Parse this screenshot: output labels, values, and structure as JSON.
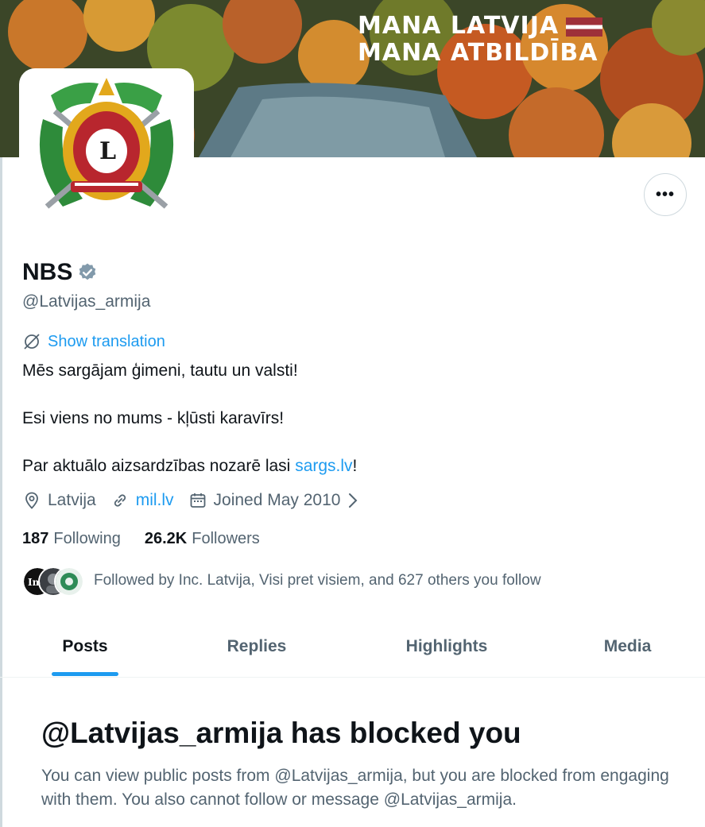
{
  "banner": {
    "line1": "MANA LATVIJA",
    "line2": "MANA ATBILDĪBA"
  },
  "profile": {
    "name": "NBS",
    "handle": "@Latvijas_armija",
    "show_translation": "Show translation",
    "bio_line1": "Mēs sargājam ģimeni, tautu un valsti!",
    "bio_line2": "Esi viens no mums - kļūsti karavīrs!",
    "bio_line3_prefix": "Par aktuālo aizsardzības nozarē lasi ",
    "bio_line3_link": "sargs.lv",
    "bio_line3_suffix": "!",
    "location": "Latvija",
    "website": "mil.lv",
    "joined": "Joined May 2010",
    "following_count": "187",
    "following_label": "Following",
    "followers_count": "26.2K",
    "followers_label": "Followers",
    "followed_by": "Followed by Inc. Latvija, Visi pret visiem, and 627 others you follow",
    "more_label": "•••"
  },
  "tabs": [
    {
      "label": "Posts",
      "active": true
    },
    {
      "label": "Replies",
      "active": false
    },
    {
      "label": "Highlights",
      "active": false
    },
    {
      "label": "Media",
      "active": false
    }
  ],
  "blocked": {
    "title": "@Latvijas_armija has blocked you",
    "body": "You can view public posts from @Latvijas_armija, but you are blocked from engaging with them. You also cannot follow or message @Latvijas_armija."
  },
  "colors": {
    "accent": "#1d9bf0",
    "text": "#0f1419",
    "muted": "#536471"
  },
  "icons": [
    "more-icon",
    "verified-icon",
    "translate-icon",
    "location-icon",
    "link-icon",
    "calendar-icon",
    "chevron-right-icon"
  ]
}
